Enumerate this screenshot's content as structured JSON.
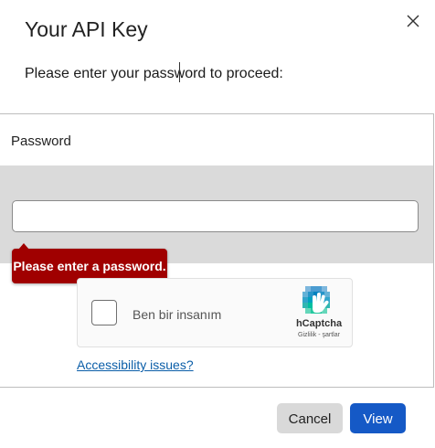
{
  "dialog": {
    "title": "Your API Key",
    "prompt": "Please enter your password to proceed:",
    "close_icon": "close-icon"
  },
  "form": {
    "password_label": "Password",
    "password_value": "",
    "error_message": "Please enter a password."
  },
  "captcha": {
    "checkbox_label": "Ben bir insanım",
    "brand": "hCaptcha",
    "links": "Gizlilik - şartlar",
    "logo_icon": "hcaptcha-hand-icon"
  },
  "accessibility_link": "Accessibility issues?",
  "buttons": {
    "cancel": "Cancel",
    "view": "View"
  },
  "colors": {
    "error": "#a00000",
    "primary": "#1559c6",
    "link": "#0b5ea8"
  }
}
